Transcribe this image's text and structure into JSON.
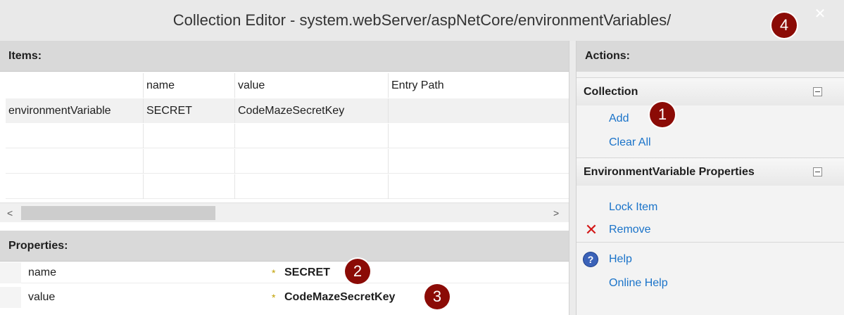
{
  "window": {
    "title": "Collection Editor - system.webServer/aspNetCore/environmentVariables/",
    "close_glyph": "✕"
  },
  "items": {
    "header": "Items:",
    "columns": [
      "",
      "name",
      "value",
      "Entry Path"
    ],
    "rows": [
      [
        "environmentVariable",
        "SECRET",
        "CodeMazeSecretKey",
        ""
      ]
    ]
  },
  "scrollbar": {
    "left_arrow": "<",
    "right_arrow": ">"
  },
  "properties": {
    "header": "Properties:",
    "rows": [
      {
        "name": "name",
        "marker": "*",
        "value": "SECRET"
      },
      {
        "name": "value",
        "marker": "*",
        "value": "CodeMazeSecretKey"
      }
    ]
  },
  "actions": {
    "header": "Actions:",
    "collection_group": {
      "title": "Collection",
      "items": [
        "Add",
        "Clear All"
      ]
    },
    "properties_group": {
      "title": "EnvironmentVariable Properties",
      "items": [
        "Lock Item",
        "Remove"
      ]
    },
    "help_group": {
      "items": [
        "Help",
        "Online Help"
      ]
    }
  },
  "callouts": [
    "1",
    "2",
    "3",
    "4"
  ],
  "icons": {
    "remove": "red-x-icon",
    "help": "help-circle-icon",
    "collapse": "collapse-box-icon"
  },
  "colors": {
    "callout": "#8b0b06",
    "link": "#1a73c9",
    "remove_x": "#d31818"
  }
}
